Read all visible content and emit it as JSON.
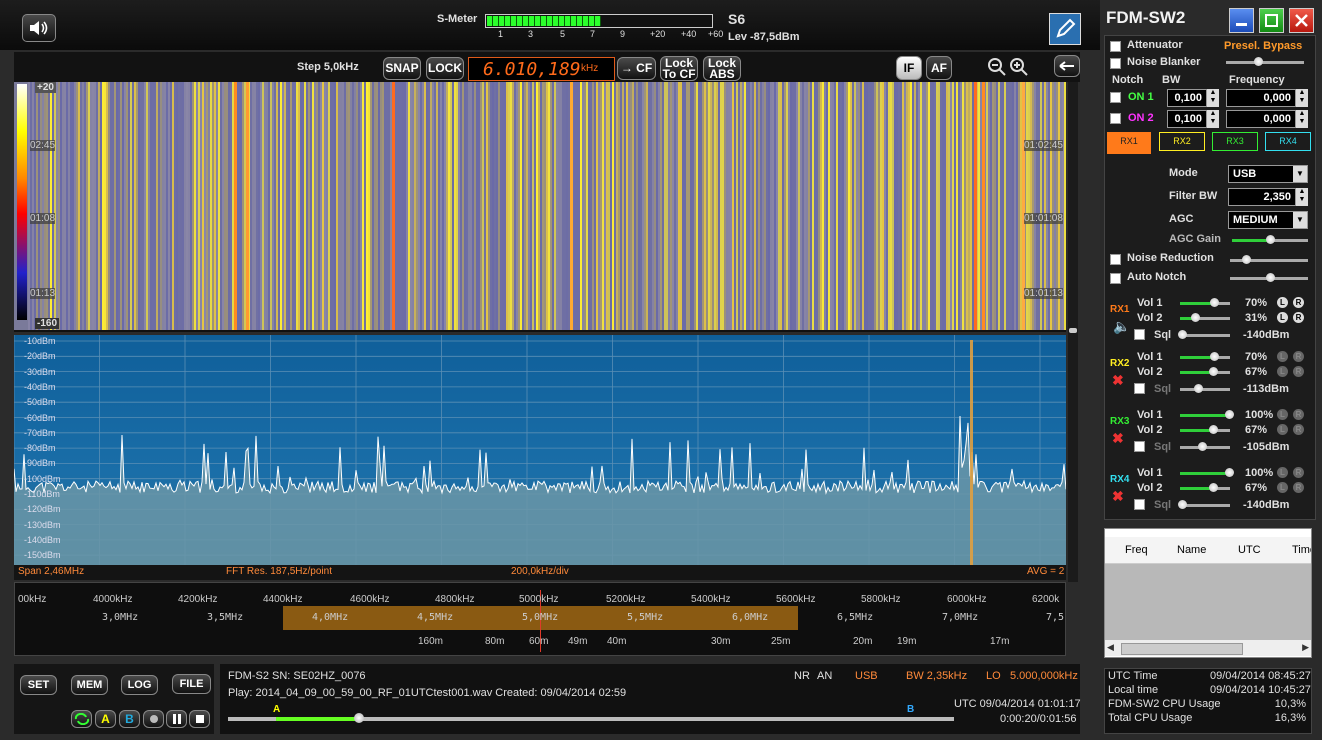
{
  "app": {
    "title": "FDM-SW2"
  },
  "smeter": {
    "label": "S-Meter",
    "scale": [
      "1",
      "3",
      "5",
      "7",
      "9",
      "+20",
      "+40",
      "+60"
    ],
    "reading": "S6",
    "level": "Lev -87,5dBm",
    "fill": 0.51
  },
  "toolbar": {
    "step": "Step 5,0kHz",
    "snap": "SNAP",
    "lock": "LOCK",
    "frequency": "6.010,189",
    "freq_unit": "kHz",
    "to_cf": "→ CF",
    "lock_to_cf": "Lock\nTo CF",
    "lock_abs": "Lock\nABS",
    "if": "IF",
    "af": "AF"
  },
  "waterfall": {
    "top_level": "+20",
    "bottom_level": "-160",
    "times": [
      "02:45",
      "01:08",
      "01:13"
    ],
    "times_right": [
      "01:02:45",
      "01:01:08",
      "01:01:13"
    ]
  },
  "spectrum": {
    "db_labels": [
      "-10dBm",
      "-20dBm",
      "-30dBm",
      "-40dBm",
      "-50dBm",
      "-60dBm",
      "-70dBm",
      "-80dBm",
      "-90dBm",
      "-100dBm",
      "-110dBm",
      "-120dBm",
      "-130dBm",
      "-140dBm",
      "-150dBm"
    ],
    "span": "Span 2,46MHz",
    "fft": "FFT Res. 187,5Hz/point",
    "div": "200,0kHz/div",
    "avg": "AVG = 2"
  },
  "freq_axis": {
    "labels": [
      "00kHz",
      "4000kHz",
      "4200kHz",
      "4400kHz",
      "4600kHz",
      "4800kHz",
      "5000kHz",
      "5200kHz",
      "5400kHz",
      "5600kHz",
      "5800kHz",
      "6000kHz",
      "6200k"
    ]
  },
  "band_axis": {
    "labels": [
      "3,0MHz",
      "3,5MHz",
      "4,0MHz",
      "4,5MHz",
      "5,0MHz",
      "5,5MHz",
      "6,0MHz",
      "6,5MHz",
      "7,0MHz",
      "7,5"
    ]
  },
  "meter_axis": {
    "labels": [
      "160m",
      "80m",
      "60m",
      "49m",
      "40m",
      "30m",
      "25m",
      "20m",
      "19m",
      "17m"
    ]
  },
  "bottom_buttons": {
    "set": "SET",
    "mem": "MEM",
    "log": "LOG",
    "file": "FILE",
    "a": "A",
    "b": "B"
  },
  "status": {
    "sn": "FDM-S2 SN: SE02HZ_0076",
    "nr": "NR",
    "an": "AN",
    "mode": "USB",
    "bw": "BW 2,35kHz",
    "lo_label": "LO",
    "lo": "5.000,000kHz",
    "play": "Play: 2014_04_09_00_59_00_RF_01UTCtest001.wav Created: 09/04/2014 02:59",
    "utc": "UTC 09/04/2014 01:01:17",
    "elapsed": "0:00:20/0:01:56",
    "marker_a": "A",
    "marker_b": "B"
  },
  "right": {
    "attenuator": "Attenuator",
    "presel": "Presel. Bypass",
    "noise_blanker": "Noise Blanker",
    "notch": "Notch",
    "bw": "BW",
    "frequency": "Frequency",
    "on1": "ON 1",
    "on2": "ON 2",
    "bw1": "0,100",
    "bw2": "0,100",
    "freq1": "0,000",
    "freq2": "0,000",
    "rx_tabs": [
      "RX1",
      "RX2",
      "RX3",
      "RX4"
    ],
    "mode_label": "Mode",
    "mode": "USB",
    "filter_label": "Filter BW",
    "filter": "2,350",
    "agc_label": "AGC",
    "agc": "MEDIUM",
    "agc_gain": "AGC Gain",
    "noise_reduction": "Noise Reduction",
    "auto_notch": "Auto Notch",
    "rx": [
      {
        "name": "RX1",
        "vol1": "70%",
        "vol2": "31%",
        "sql": "-140dBm",
        "v1": 0.7,
        "v2": 0.31,
        "color": "#ff7a1a"
      },
      {
        "name": "RX2",
        "vol1": "70%",
        "vol2": "67%",
        "sql": "-113dBm",
        "v1": 0.7,
        "v2": 0.67,
        "color": "#ffee22"
      },
      {
        "name": "RX3",
        "vol1": "100%",
        "vol2": "67%",
        "sql": "-105dBm",
        "v1": 1.0,
        "v2": 0.67,
        "color": "#33ee33"
      },
      {
        "name": "RX4",
        "vol1": "100%",
        "vol2": "67%",
        "sql": "-140dBm",
        "v1": 1.0,
        "v2": 0.67,
        "color": "#33e0f0"
      }
    ],
    "vol1_label": "Vol 1",
    "vol2_label": "Vol 2",
    "sql_label": "Sql",
    "l": "L",
    "r": "R",
    "table_headers": [
      "Freq",
      "Name",
      "UTC",
      "Time"
    ],
    "info": [
      {
        "label": "UTC Time",
        "value": "09/04/2014 08:45:27"
      },
      {
        "label": "Local time",
        "value": "09/04/2014 10:45:27"
      },
      {
        "label": "FDM-SW2 CPU Usage",
        "value": "10,3%"
      },
      {
        "label": "Total CPU Usage",
        "value": "16,3%"
      }
    ]
  }
}
